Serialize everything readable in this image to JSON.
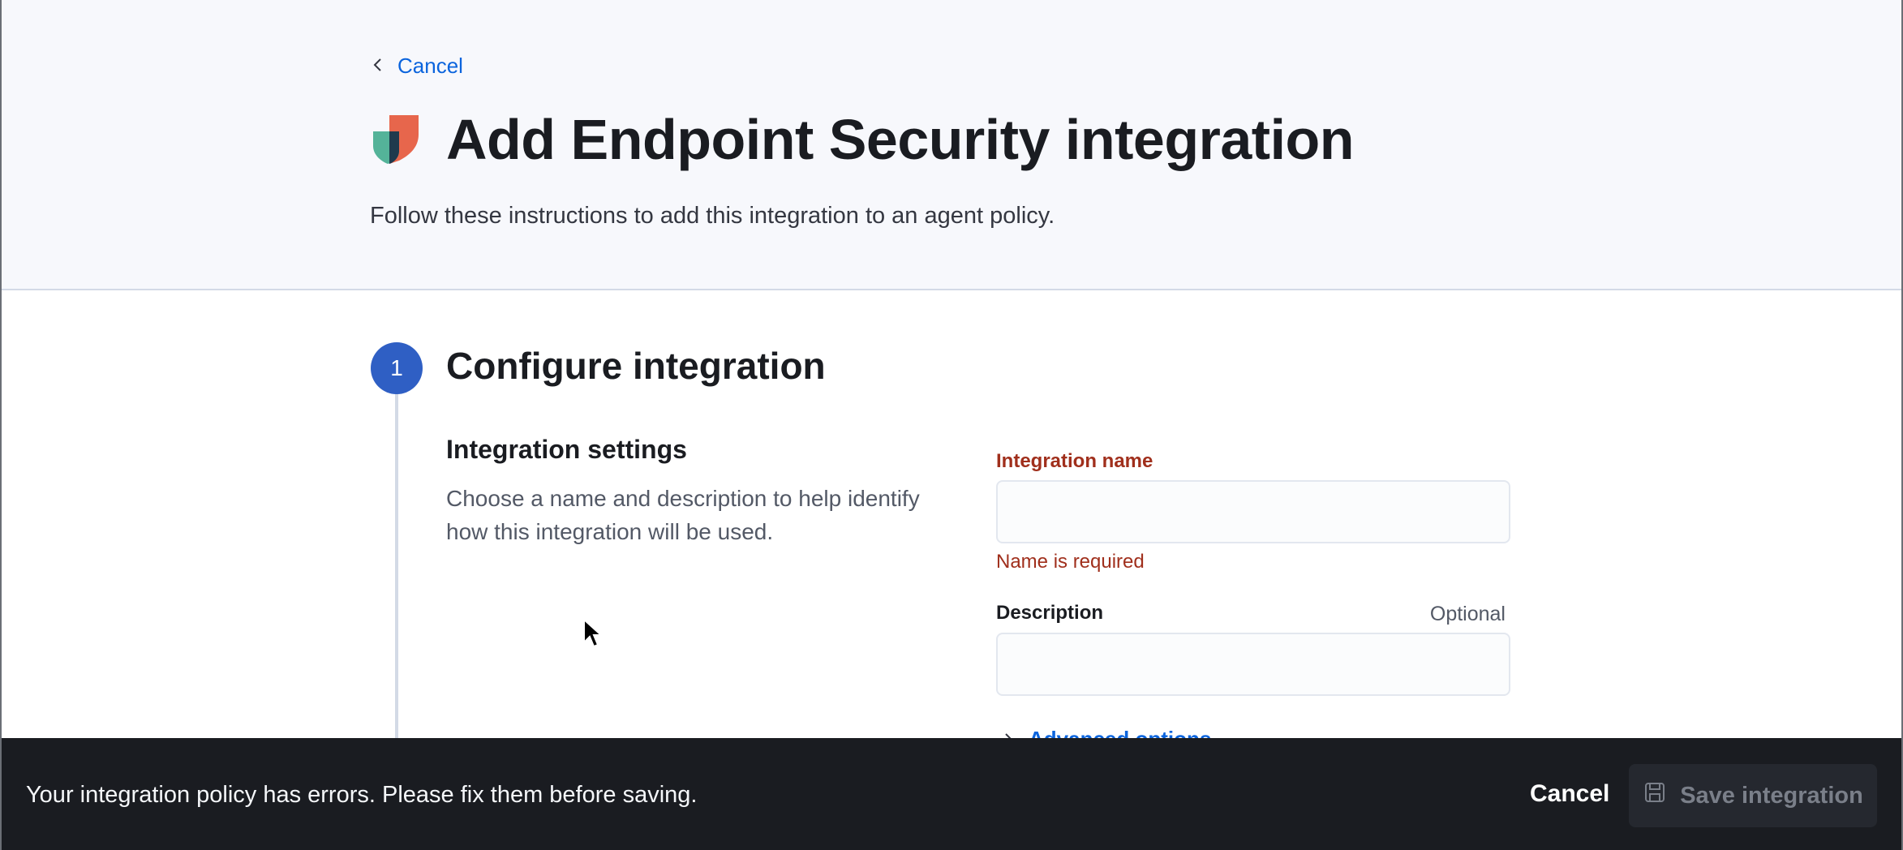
{
  "header": {
    "back_label": "Cancel",
    "title": "Add Endpoint Security integration",
    "subtitle": "Follow these instructions to add this integration to an agent policy."
  },
  "step": {
    "number": "1",
    "title": "Configure integration"
  },
  "settings": {
    "title": "Integration settings",
    "description": "Choose a name and description to help identify how this integration will be used.",
    "name_label": "Integration name",
    "name_value": "",
    "name_error": "Name is required",
    "description_label": "Description",
    "description_optional": "Optional",
    "description_value": "",
    "advanced_label": "Advanced options"
  },
  "bottom_bar": {
    "message": "Your integration policy has errors. Please fix them before saving.",
    "cancel_label": "Cancel",
    "save_label": "Save integration",
    "save_disabled": true
  },
  "colors": {
    "accent": "#0b64dd",
    "step_circle": "#2f5fc4",
    "error": "#a02f1c",
    "bottom_bar_bg": "#1a1c21",
    "header_bg": "#f7f8fc"
  },
  "icons": {
    "back": "chevron-left-icon",
    "logo": "endpoint-security-logo-icon",
    "advanced": "chevron-right-icon",
    "save": "save-icon"
  }
}
